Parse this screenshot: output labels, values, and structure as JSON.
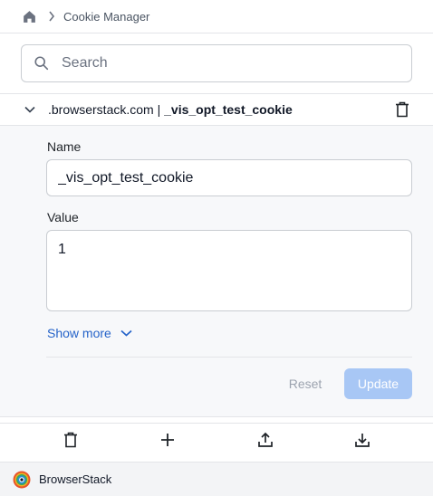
{
  "breadcrumb": {
    "home_icon": "home-icon",
    "separator_icon": "chevron-right-icon",
    "current": "Cookie Manager"
  },
  "search": {
    "placeholder": "Search",
    "value": ""
  },
  "cookie": {
    "domain": ".browserstack.com |",
    "name_title": "_vis_opt_test_cookie",
    "expand_icon": "chevron-down-icon",
    "delete_icon": "trash-icon"
  },
  "form": {
    "name_label": "Name",
    "name_value": "_vis_opt_test_cookie",
    "value_label": "Value",
    "value_value": "1",
    "show_more_label": "Show more",
    "reset_label": "Reset",
    "update_label": "Update"
  },
  "toolbar": {
    "items": [
      "trash-icon",
      "plus-icon",
      "upload-icon",
      "download-icon"
    ]
  },
  "footer": {
    "brand": "BrowserStack"
  },
  "colors": {
    "accent": "#2563c9",
    "update_disabled": "#a8c7f5",
    "panel_bg": "#f7f8fa",
    "border": "#c9cdd2"
  }
}
